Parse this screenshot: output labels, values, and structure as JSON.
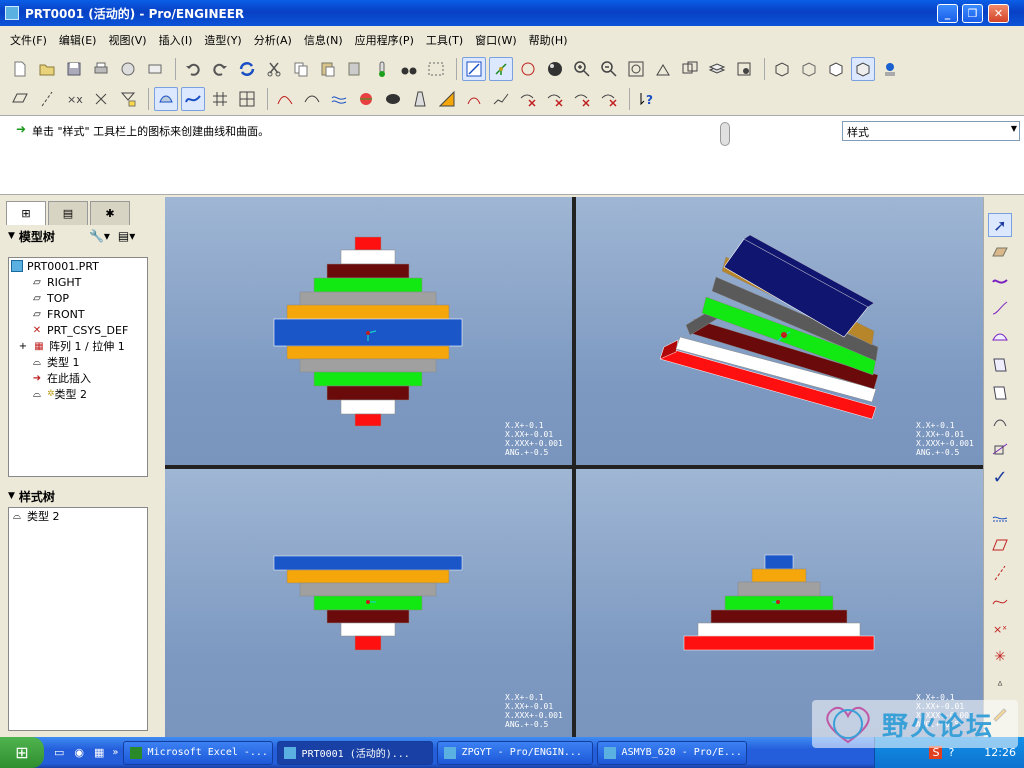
{
  "window": {
    "title": "PRT0001 (活动的) - Pro/ENGINEER",
    "min_icon": "minimize-icon",
    "max_icon": "maximize-icon",
    "close_icon": "close-icon"
  },
  "menu": [
    "文件(F)",
    "编辑(E)",
    "视图(V)",
    "插入(I)",
    "造型(Y)",
    "分析(A)",
    "信息(N)",
    "应用程序(P)",
    "工具(T)",
    "窗口(W)",
    "帮助(H)"
  ],
  "message": {
    "text": "单击 \"样式\" 工具栏上的图标来创建曲线和曲面。"
  },
  "filter": {
    "selected": "样式"
  },
  "model_tree": {
    "header": "模型树",
    "items": [
      "PRT0001.PRT",
      "RIGHT",
      "TOP",
      "FRONT",
      "PRT_CSYS_DEF",
      "阵列 1 / 拉伸 1",
      "类型 1",
      "在此插入",
      "类型 2"
    ]
  },
  "style_tree": {
    "header": "样式树",
    "items": [
      "类型 2"
    ]
  },
  "accuracy_readout": [
    "X.X+-0.1",
    "X.XX+-0.01",
    "X.XXX+-0.001",
    "ANG.+-0.5"
  ],
  "taskbar": {
    "tasks": [
      "Microsoft Excel -...",
      "PRT0001 (活动的)...",
      "ZPGYT - Pro/ENGIN...",
      "ASMYB_620 - Pro/E..."
    ],
    "clock": "12:26"
  },
  "watermark": {
    "text": "野火论坛"
  },
  "colors": {
    "red": "#ff1010",
    "white": "#ffffff",
    "maroon": "#6a0a0a",
    "green": "#12e812",
    "gray": "#a0a0a0",
    "orange": "#f5a60a",
    "blue": "#1a56c8",
    "navy": "#101670",
    "brown": "#b8862a",
    "darkgray": "#5a5a5a"
  }
}
